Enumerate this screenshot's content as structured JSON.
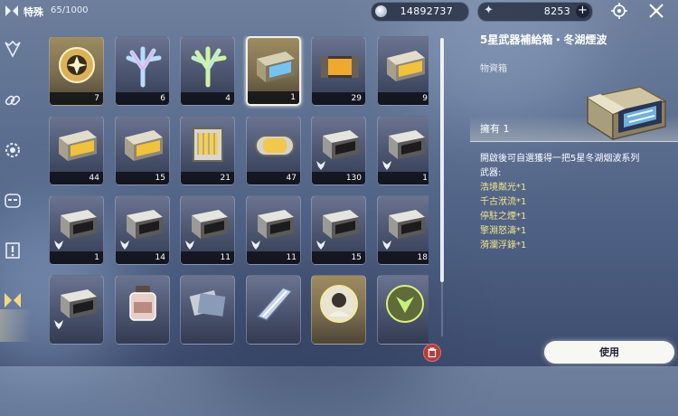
{
  "topbar": {
    "category_label": "特殊",
    "category_count": "65/1000",
    "currency1_value": "14892737",
    "currency2_value": "8253",
    "plus_label": "+"
  },
  "sidebar": {
    "items": [
      {
        "icon": "crest-icon",
        "active": false
      },
      {
        "icon": "link-icon",
        "active": false
      },
      {
        "icon": "gear-target-icon",
        "active": false
      },
      {
        "icon": "mask-icon",
        "active": false
      },
      {
        "icon": "exclamation-icon",
        "active": false
      },
      {
        "icon": "special-icon",
        "active": true
      }
    ]
  },
  "grid": {
    "items": [
      {
        "qty": "7",
        "art": "orb",
        "selected": false,
        "gold": true,
        "lock": false
      },
      {
        "qty": "6",
        "art": "coral-blue",
        "selected": false,
        "gold": false,
        "lock": false
      },
      {
        "qty": "4",
        "art": "coral-green",
        "selected": false,
        "gold": false,
        "lock": false
      },
      {
        "qty": "1",
        "art": "chest-blue",
        "selected": true,
        "gold": true,
        "lock": false
      },
      {
        "qty": "29",
        "art": "chest-orange",
        "selected": false,
        "gold": false,
        "lock": false
      },
      {
        "qty": "9",
        "art": "chest-gold",
        "selected": false,
        "gold": false,
        "lock": false
      },
      {
        "qty": "44",
        "art": "chest-gold",
        "selected": false,
        "gold": false,
        "lock": false
      },
      {
        "qty": "15",
        "art": "chest-gold",
        "selected": false,
        "gold": false,
        "lock": false
      },
      {
        "qty": "21",
        "art": "cage",
        "selected": false,
        "gold": false,
        "lock": false
      },
      {
        "qty": "47",
        "art": "capsule",
        "selected": false,
        "gold": false,
        "lock": false
      },
      {
        "qty": "130",
        "art": "chest-silver",
        "selected": false,
        "gold": false,
        "lock": true
      },
      {
        "qty": "1",
        "art": "chest-silver",
        "selected": false,
        "gold": false,
        "lock": true
      },
      {
        "qty": "1",
        "art": "chest-silver",
        "selected": false,
        "gold": false,
        "lock": true
      },
      {
        "qty": "14",
        "art": "chest-silver",
        "selected": false,
        "gold": false,
        "lock": true
      },
      {
        "qty": "11",
        "art": "chest-silver",
        "selected": false,
        "gold": false,
        "lock": true
      },
      {
        "qty": "11",
        "art": "chest-silver",
        "selected": false,
        "gold": false,
        "lock": true
      },
      {
        "qty": "15",
        "art": "chest-silver",
        "selected": false,
        "gold": false,
        "lock": true
      },
      {
        "qty": "18",
        "art": "chest-silver",
        "selected": false,
        "gold": false,
        "lock": true
      },
      {
        "qty": "",
        "art": "chest-silver",
        "selected": false,
        "gold": false,
        "lock": true
      },
      {
        "qty": "",
        "art": "bottle",
        "selected": false,
        "gold": false,
        "lock": false
      },
      {
        "qty": "",
        "art": "cards",
        "selected": false,
        "gold": false,
        "lock": false
      },
      {
        "qty": "",
        "art": "crystal",
        "selected": false,
        "gold": false,
        "lock": false
      },
      {
        "qty": "",
        "art": "portrait",
        "selected": false,
        "gold": true,
        "lock": false
      },
      {
        "qty": "",
        "art": "emblem",
        "selected": false,
        "gold": false,
        "lock": false
      }
    ]
  },
  "detail": {
    "title": "5星武器補給箱・冬湖煙波",
    "subtitle": "物資箱",
    "owned": "擁有 1",
    "description": "開啟後可自選獲得一把5星冬湖烟波系列",
    "weapons_label": "武器:",
    "weapons": [
      "浩境粼光*1",
      "千古洑流*1",
      "停駐之煙*1",
      "擎淵怒濤*1",
      "漪瀾浮錄*1"
    ],
    "use_label": "使用"
  },
  "colors": {
    "highlight_text": "#f4e38e",
    "trash_red": "#b53c3c"
  }
}
